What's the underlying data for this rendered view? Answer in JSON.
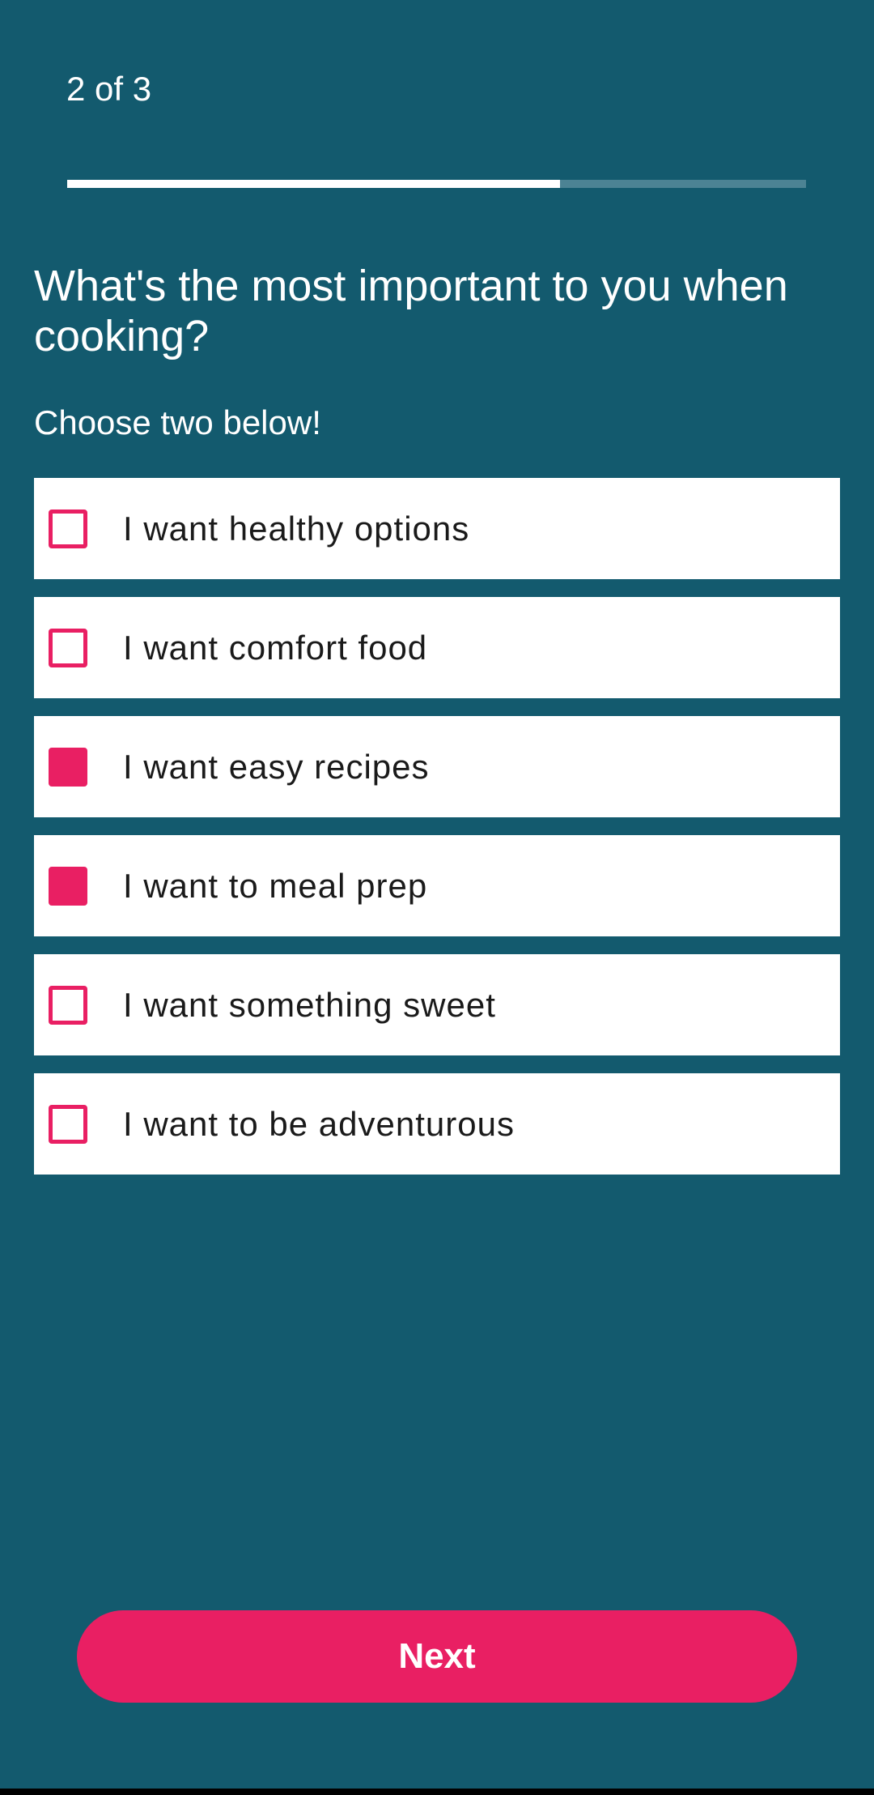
{
  "progress": {
    "step_label": "2 of 3",
    "fraction": 0.667
  },
  "question": {
    "title": "What's the most important to you when cooking?",
    "subtitle": "Choose two below!"
  },
  "options": [
    {
      "label": "I want healthy options",
      "checked": false
    },
    {
      "label": "I want comfort food",
      "checked": false
    },
    {
      "label": "I want easy recipes",
      "checked": true
    },
    {
      "label": "I want to meal prep",
      "checked": true
    },
    {
      "label": "I want something sweet",
      "checked": false
    },
    {
      "label": "I want to be adventurous",
      "checked": false
    }
  ],
  "actions": {
    "next_label": "Next"
  },
  "colors": {
    "background": "#135a6e",
    "accent": "#e91f63",
    "progress_track": "#4c8394",
    "progress_fill": "#ffffff"
  }
}
